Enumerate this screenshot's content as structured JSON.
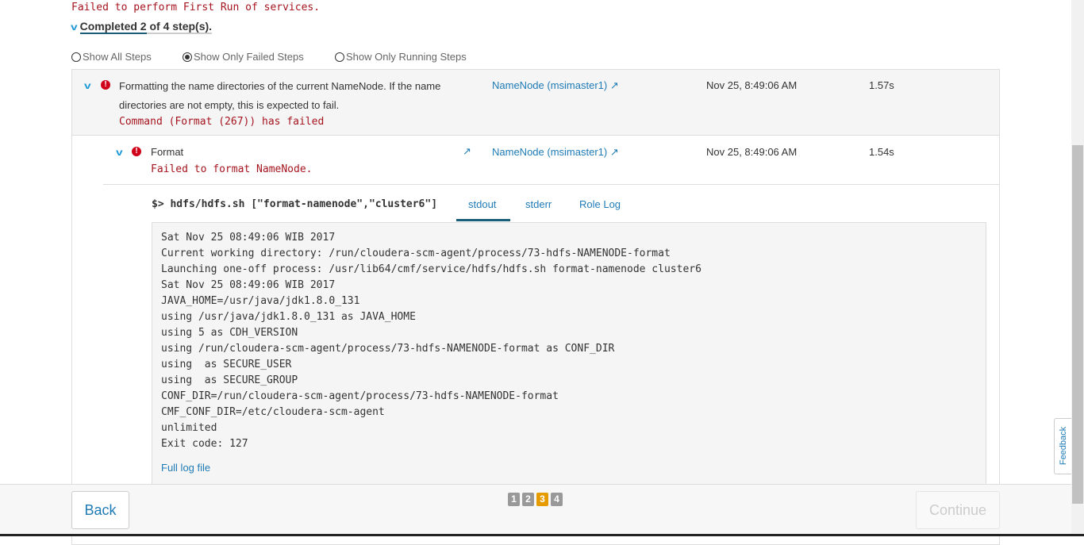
{
  "header_message": "Failed to perform First Run of services.",
  "summary": {
    "completed_label": "Completed 2",
    "rest": " of 4 step(s)."
  },
  "filters": [
    {
      "label": "Show All Steps",
      "selected": false
    },
    {
      "label": "Show Only Failed Steps",
      "selected": true
    },
    {
      "label": "Show Only Running Steps",
      "selected": false
    }
  ],
  "step": {
    "description_1": "Formatting the name directories of the current NameNode. If the name",
    "description_2": "directories are not empty, this is expected to fail.",
    "error": "Command (Format (267)) has failed",
    "host": "NameNode (msimaster1)",
    "time": "Nov 25, 8:49:06 AM",
    "duration": "1.57s"
  },
  "substep": {
    "title": "Format",
    "error": "Failed to format NameNode.",
    "host": "NameNode (msimaster1)",
    "time": "Nov 25, 8:49:06 AM",
    "duration": "1.54s"
  },
  "command": {
    "prompt": "$>",
    "text": "hdfs/hdfs.sh [\"format-namenode\",\"cluster6\"]"
  },
  "tabs": [
    "stdout",
    "stderr",
    "Role Log"
  ],
  "log_lines": [
    "Sat Nov 25 08:49:06 WIB 2017",
    "Current working directory: /run/cloudera-scm-agent/process/73-hdfs-NAMENODE-format",
    "Launching one-off process: /usr/lib64/cmf/service/hdfs/hdfs.sh format-namenode cluster6",
    "Sat Nov 25 08:49:06 WIB 2017",
    "JAVA_HOME=/usr/java/jdk1.8.0_131",
    "using /usr/java/jdk1.8.0_131 as JAVA_HOME",
    "using 5 as CDH_VERSION",
    "using /run/cloudera-scm-agent/process/73-hdfs-NAMENODE-format as CONF_DIR",
    "using  as SECURE_USER",
    "using  as SECURE_GROUP",
    "CONF_DIR=/run/cloudera-scm-agent/process/73-hdfs-NAMENODE-format",
    "CMF_CONF_DIR=/etc/cloudera-scm-agent",
    "unlimited",
    "Exit code: 127"
  ],
  "full_log": "Full log file",
  "footer": {
    "back": "Back",
    "continue": "Continue",
    "pages": [
      "1",
      "2",
      "3",
      "4"
    ],
    "current_page": 3
  },
  "feedback": "Feedback"
}
